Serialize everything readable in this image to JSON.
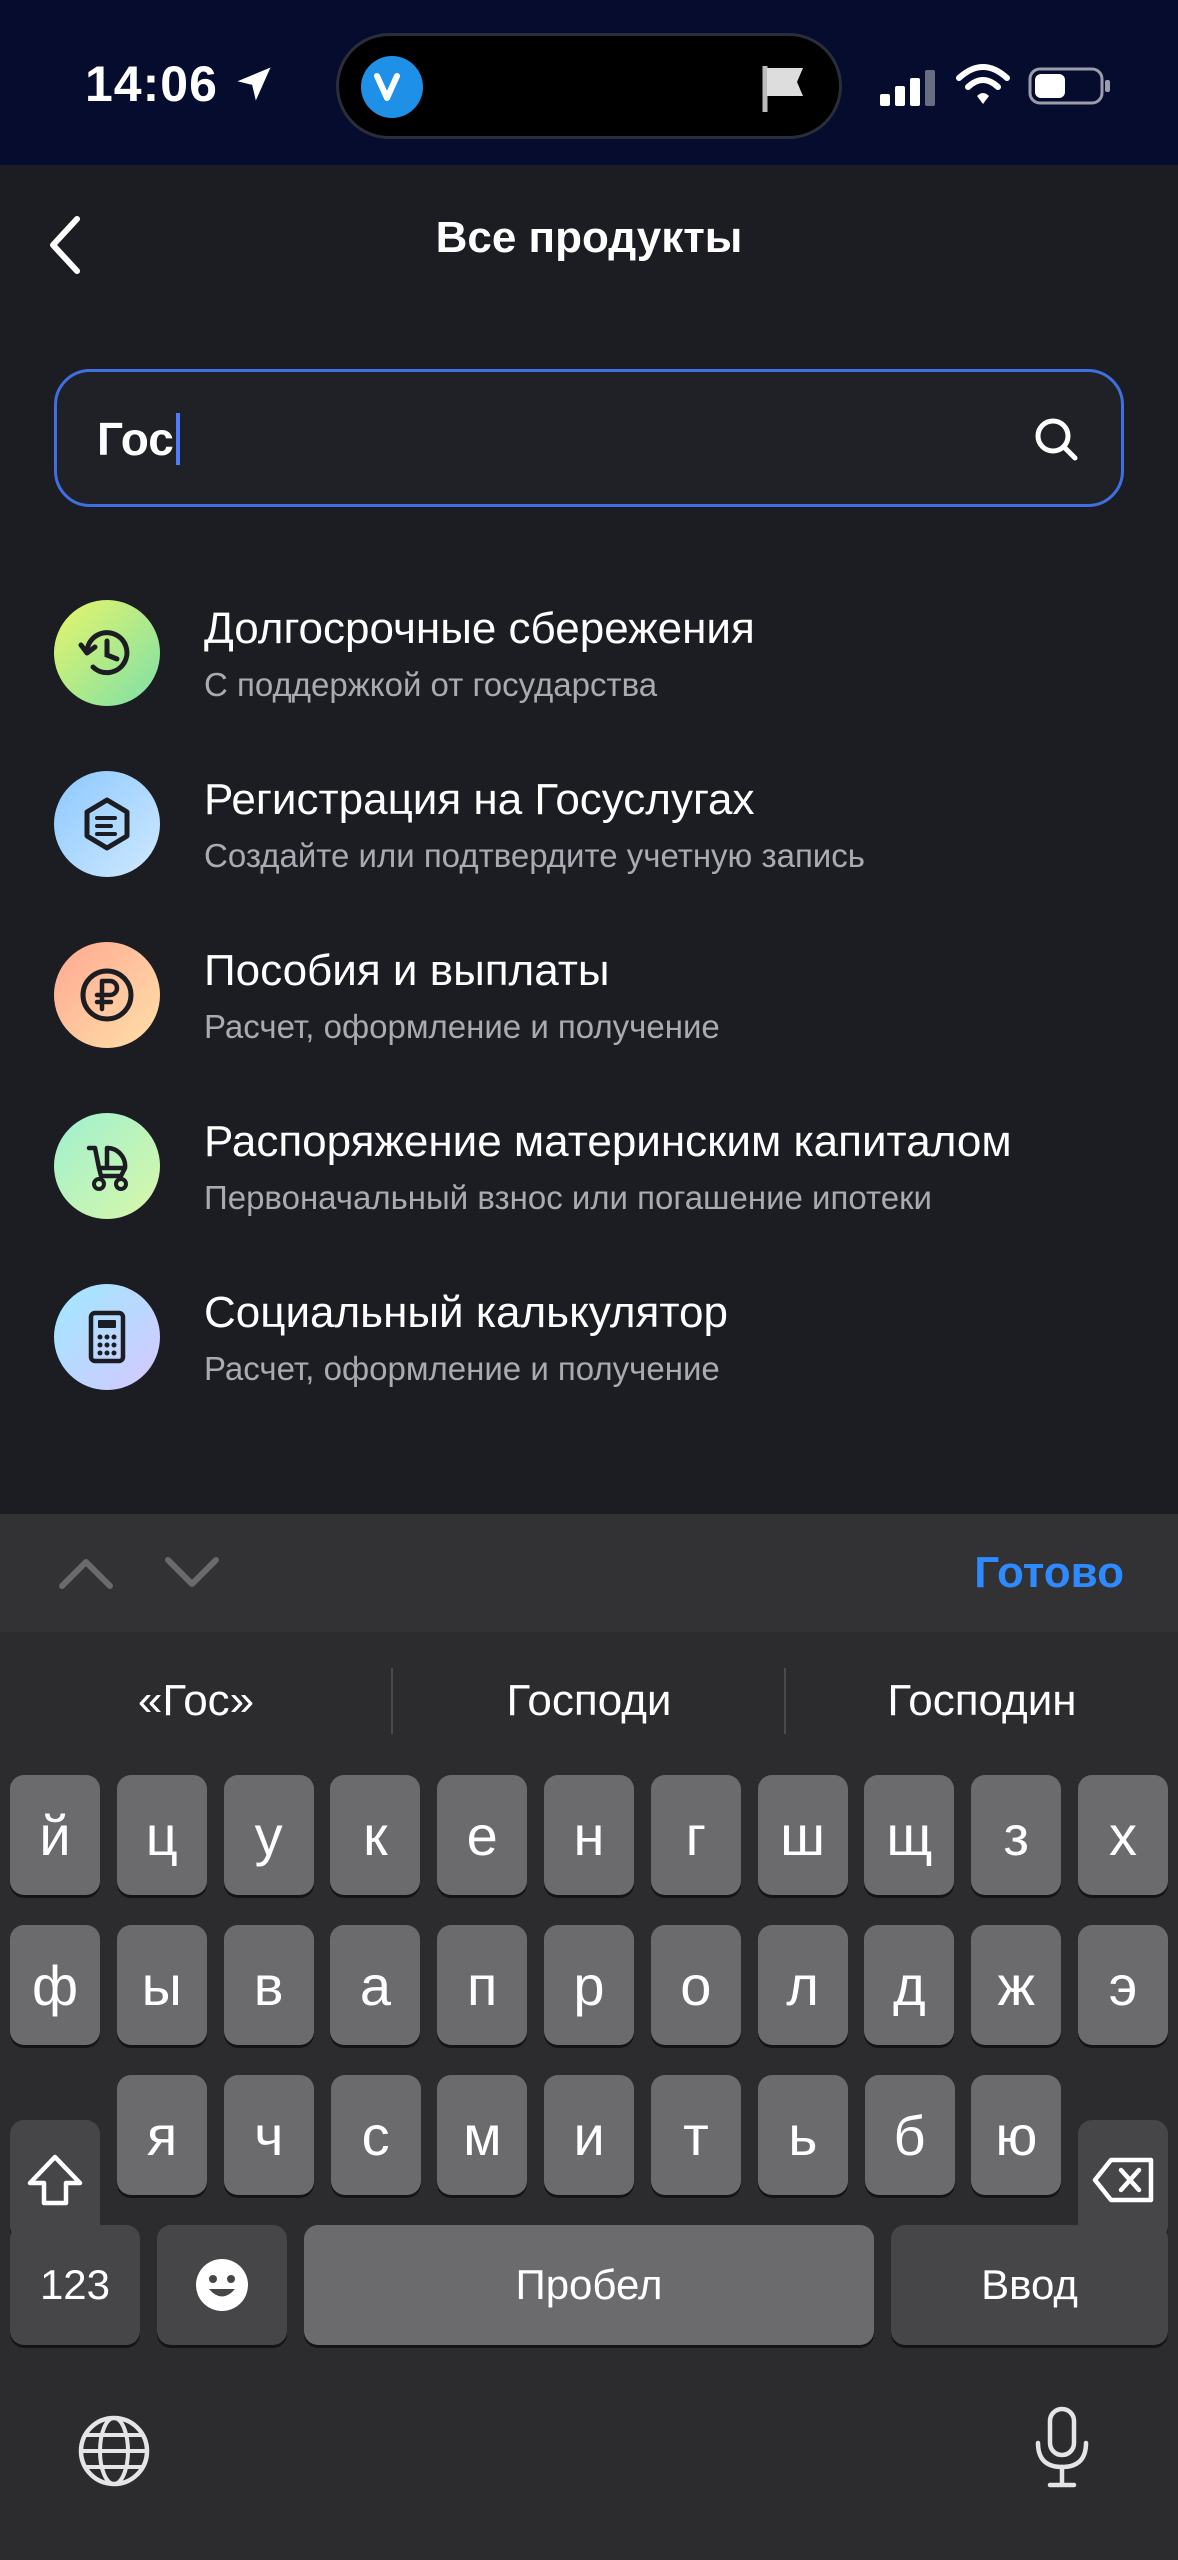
{
  "status_bar": {
    "time": "14:06"
  },
  "header": {
    "title": "Все продукты"
  },
  "search": {
    "value": "Гос"
  },
  "products": [
    {
      "title": "Долгосрочные сбережения",
      "subtitle": "С поддержкой от государства",
      "icon": "savings-clock-icon",
      "colors": [
        "#d9f36a",
        "#7de0a8"
      ]
    },
    {
      "title": "Регистрация на Госуслугах",
      "subtitle": "Создайте или подтвердите учетную запись",
      "icon": "gosuslugi-icon",
      "colors": [
        "#9fd0ff",
        "#c9e6ff"
      ]
    },
    {
      "title": "Пособия и выплаты",
      "subtitle": "Расчет, оформление и получение",
      "icon": "ruble-icon",
      "colors": [
        "#ffb59a",
        "#ffd8a8"
      ]
    },
    {
      "title": "Распоряжение материнским капиталом",
      "subtitle": "Первоначальный взнос или погашение ипотеки",
      "icon": "stroller-icon",
      "colors": [
        "#a8f0c8",
        "#d0f7b0"
      ]
    },
    {
      "title": "Социальный калькулятор",
      "subtitle": "Расчет, оформление и получение",
      "icon": "calculator-icon",
      "colors": [
        "#a8e6ff",
        "#d4c8ff"
      ]
    }
  ],
  "accessory": {
    "done_label": "Готово"
  },
  "keyboard": {
    "suggestions": [
      "«Гос»",
      "Господи",
      "Господин"
    ],
    "row1": [
      "й",
      "ц",
      "у",
      "к",
      "е",
      "н",
      "г",
      "ш",
      "щ",
      "з",
      "х"
    ],
    "row2": [
      "ф",
      "ы",
      "в",
      "а",
      "п",
      "р",
      "о",
      "л",
      "д",
      "ж",
      "э"
    ],
    "row3": [
      "я",
      "ч",
      "с",
      "м",
      "и",
      "т",
      "ь",
      "б",
      "ю"
    ],
    "numbers_label": "123",
    "space_label": "Пробел",
    "return_label": "Ввод"
  },
  "colors": {
    "accent": "#2d8bff",
    "search_border": "#3f6fe0",
    "background": "#1c1d22",
    "status_bar": "#060c2e"
  }
}
